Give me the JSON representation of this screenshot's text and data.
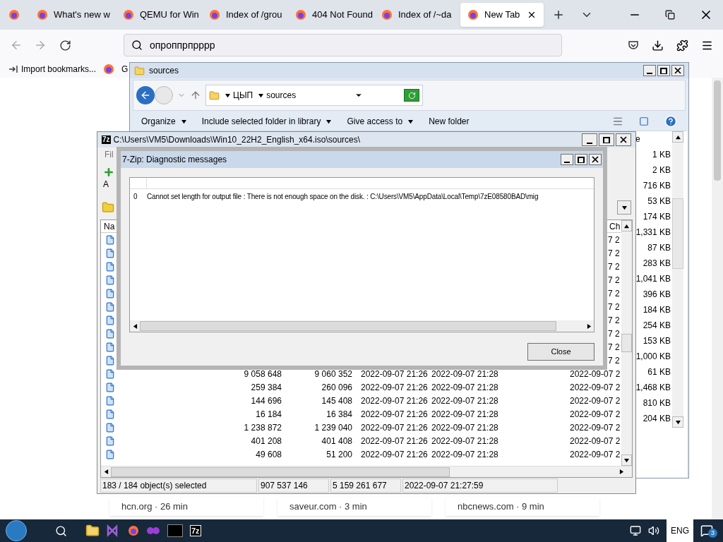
{
  "browser": {
    "tabs": [
      {
        "label": "What's new w",
        "selected": false
      },
      {
        "label": "QEMU for Win",
        "selected": false
      },
      {
        "label": "Index of /grou",
        "selected": false
      },
      {
        "label": "404 Not Found",
        "selected": false
      },
      {
        "label": "Index of /~da",
        "selected": false
      },
      {
        "label": "New Tab",
        "selected": true
      }
    ],
    "address": "опроппрпрррр",
    "bookmarks": [
      "Import bookmarks...",
      "G"
    ],
    "cards": [
      "hcn.org · 26 min",
      "saveur.com · 3 min",
      "nbcnews.com · 9 min"
    ]
  },
  "explorer": {
    "title": "sources",
    "breadcrumbs": [
      "ЦЫП",
      "sources"
    ],
    "toolbar": [
      "Organize",
      "Include selected folder in library",
      "Give access to",
      "New folder"
    ],
    "size_header": "e",
    "sizes": [
      "1 KB",
      "2 KB",
      "716 KB",
      "53 KB",
      "174 KB",
      "1,331 KB",
      "87 KB",
      "283 KB",
      "1,041 KB",
      "396 KB",
      "184 KB",
      "254 KB",
      "153 KB",
      "1,000 KB",
      "61 KB",
      "1,468 KB",
      "810 KB",
      "204 KB"
    ]
  },
  "sevenzip": {
    "logo": "7z",
    "title": "C:\\Users\\VM5\\Downloads\\Win10_22H2_English_x64.iso\\sources\\",
    "menu": "Fil",
    "toolbar_label": "A",
    "columns": [
      "Na",
      "Ch"
    ],
    "rows": [
      {
        "accessed": "7 2"
      },
      {
        "accessed": "7 2"
      },
      {
        "accessed": "7 2"
      },
      {
        "accessed": "7 2"
      },
      {
        "accessed": "7 2"
      },
      {
        "accessed": "7 2"
      },
      {
        "accessed": "7 2"
      },
      {
        "accessed": "7 2"
      },
      {
        "accessed": "7 2"
      },
      {
        "accessed": "7 2"
      },
      {
        "size": "9 058 648",
        "packed": "9 060 352",
        "modified": "2022-09-07 21:26",
        "created": "2022-09-07 21:28",
        "accessed": "2022-09-07 2"
      },
      {
        "size": "259 384",
        "packed": "260 096",
        "modified": "2022-09-07 21:26",
        "created": "2022-09-07 21:28",
        "accessed": "2022-09-07 2"
      },
      {
        "size": "144 696",
        "packed": "145 408",
        "modified": "2022-09-07 21:26",
        "created": "2022-09-07 21:28",
        "accessed": "2022-09-07 2"
      },
      {
        "size": "16 184",
        "packed": "16 384",
        "modified": "2022-09-07 21:26",
        "created": "2022-09-07 21:28",
        "accessed": "2022-09-07 2"
      },
      {
        "size": "1 238 872",
        "packed": "1 239 040",
        "modified": "2022-09-07 21:26",
        "created": "2022-09-07 21:28",
        "accessed": "2022-09-07 2"
      },
      {
        "size": "401 208",
        "packed": "401 408",
        "modified": "2022-09-07 21:26",
        "created": "2022-09-07 21:28",
        "accessed": "2022-09-07 2"
      },
      {
        "size": "49 608",
        "packed": "51 200",
        "modified": "2022-09-07 21:26",
        "created": "2022-09-07 21:28",
        "accessed": "2022-09-07 2"
      }
    ],
    "status": [
      "183 / 184 object(s) selected",
      "907 537 146",
      "5 159 261 677",
      "2022-09-07 21:27:59"
    ]
  },
  "dialog": {
    "title": "7-Zip: Diagnostic messages",
    "messages": [
      {
        "index": "0",
        "text": "Cannot set length for output file : There is not enough space on the disk. : C:\\Users\\VM5\\AppData\\Local\\Temp\\7zE08580BAD\\mig"
      }
    ],
    "button": "Close"
  },
  "taskbar": {
    "logo": "7z",
    "language": "ENG",
    "notifications": "3"
  }
}
